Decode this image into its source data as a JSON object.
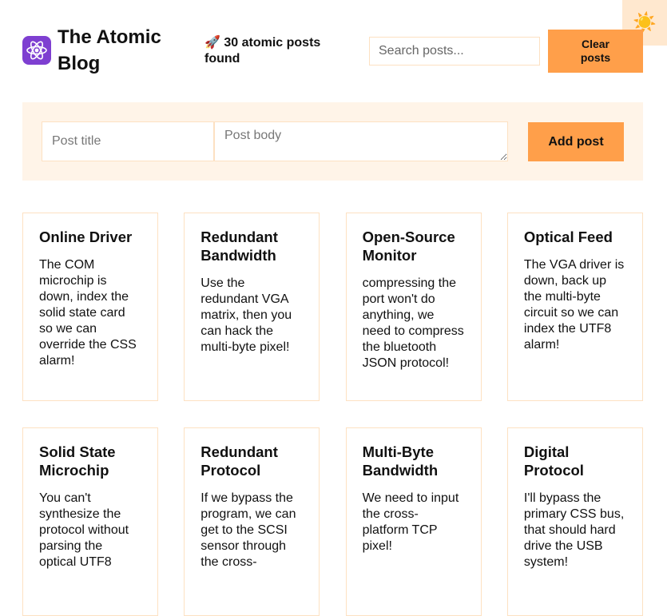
{
  "theme_toggle": {
    "icon": "sun-icon",
    "glyph": "☀️"
  },
  "header": {
    "logo_icon": "atom-icon",
    "title": "The Atomic Blog",
    "result_text": "🚀 30 atomic posts found",
    "search_placeholder": "Search posts...",
    "clear_label": "Clear posts"
  },
  "form": {
    "title_placeholder": "Post title",
    "body_placeholder": "Post body",
    "submit_label": "Add post"
  },
  "colors": {
    "accent": "#ff9f4a",
    "panel": "#fff4e8",
    "border": "#fde1c2",
    "logo": "#7e3fd1"
  },
  "posts": [
    {
      "title": "Online Driver",
      "body": "The COM microchip is down, index the solid state card so we can override the CSS alarm!"
    },
    {
      "title": "Redundant Bandwidth",
      "body": "Use the redundant VGA matrix, then you can hack the multi-byte pixel!"
    },
    {
      "title": "Open-Source Monitor",
      "body": "compressing the port won't do anything, we need to compress the bluetooth JSON protocol!"
    },
    {
      "title": "Optical Feed",
      "body": "The VGA driver is down, back up the multi-byte circuit so we can index the UTF8 alarm!"
    },
    {
      "title": "Solid State Microchip",
      "body": "You can't synthesize the protocol without parsing the optical UTF8"
    },
    {
      "title": "Redundant Protocol",
      "body": "If we bypass the program, we can get to the SCSI sensor through the cross-"
    },
    {
      "title": "Multi-Byte Bandwidth",
      "body": "We need to input the cross-platform TCP pixel!"
    },
    {
      "title": "Digital Protocol",
      "body": "I'll bypass the primary CSS bus, that should hard drive the USB system!"
    }
  ]
}
